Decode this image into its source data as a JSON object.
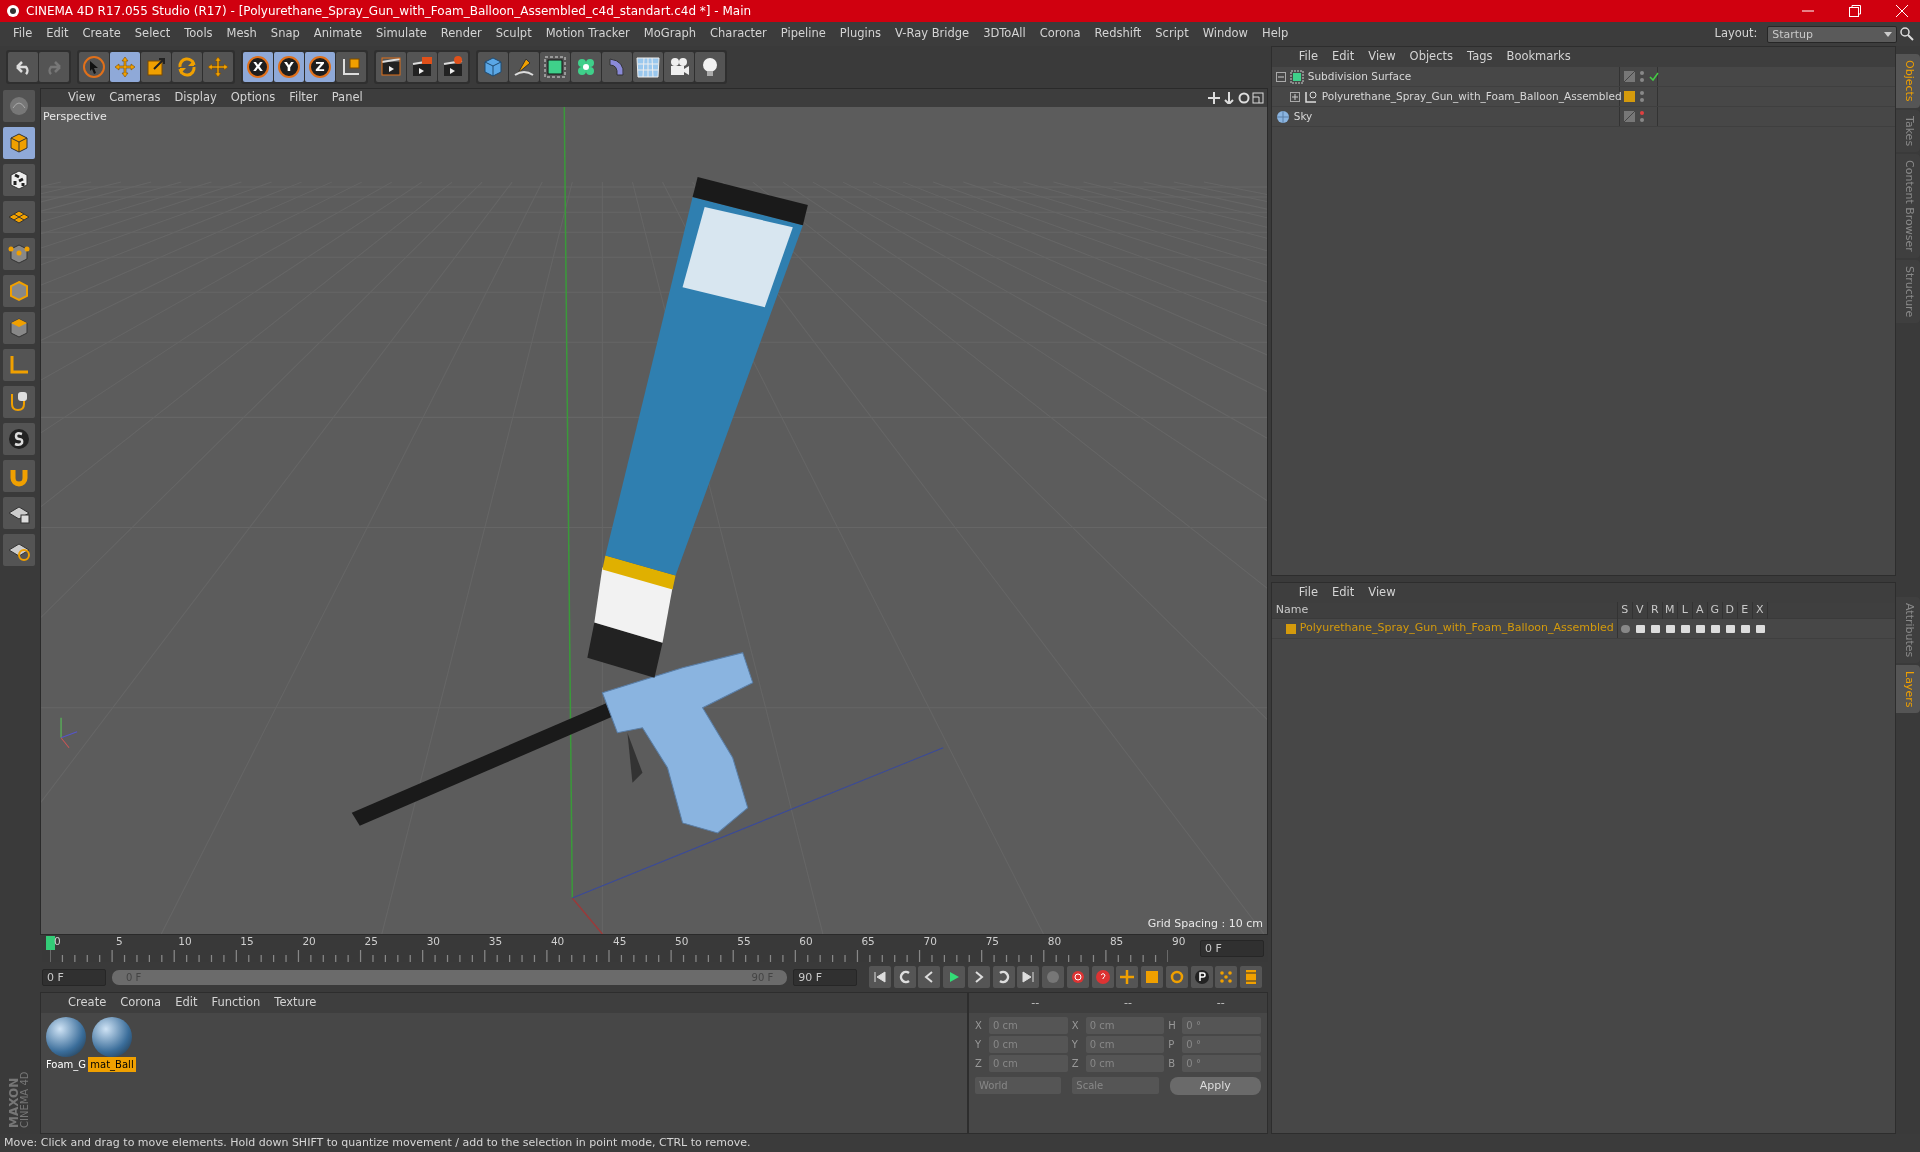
{
  "window": {
    "title": "CINEMA 4D R17.055 Studio (R17) - [Polyurethane_Spray_Gun_with_Foam_Balloon_Assembled_c4d_standart.c4d *] - Main"
  },
  "menu": [
    "File",
    "Edit",
    "Create",
    "Select",
    "Tools",
    "Mesh",
    "Snap",
    "Animate",
    "Simulate",
    "Render",
    "Sculpt",
    "Motion Tracker",
    "MoGraph",
    "Character",
    "Pipeline",
    "Plugins",
    "V-Ray Bridge",
    "3DToAll",
    "Corona",
    "Redshift",
    "Script",
    "Window",
    "Help"
  ],
  "layout": {
    "label": "Layout:",
    "value": "Startup"
  },
  "toolbar": [
    {
      "kind": "undo",
      "selected": false
    },
    {
      "kind": "redo",
      "selected": false
    },
    {
      "kind": "select",
      "selected": false
    },
    {
      "kind": "move",
      "selected": true
    },
    {
      "kind": "scale",
      "selected": false
    },
    {
      "kind": "rotate",
      "selected": false
    },
    {
      "kind": "move",
      "selected": false
    },
    {
      "kind": "axis",
      "label": "X",
      "selected": true
    },
    {
      "kind": "axis",
      "label": "Y",
      "selected": true
    },
    {
      "kind": "axis",
      "label": "Z",
      "selected": true
    },
    {
      "kind": "coords",
      "selected": false
    },
    {
      "kind": "render-view",
      "selected": false
    },
    {
      "kind": "render",
      "selected": false
    },
    {
      "kind": "render-settings",
      "selected": false
    },
    {
      "kind": "cube",
      "selected": false
    },
    {
      "kind": "pen",
      "selected": false
    },
    {
      "kind": "subdiv",
      "selected": false
    },
    {
      "kind": "cloner",
      "selected": false
    },
    {
      "kind": "deformer",
      "selected": false
    },
    {
      "kind": "floor",
      "selected": false
    },
    {
      "kind": "camera",
      "selected": false
    },
    {
      "kind": "light",
      "selected": false
    }
  ],
  "left_tools": [
    {
      "kind": "sculpt",
      "selected": false
    },
    {
      "kind": "model",
      "selected": true
    },
    {
      "kind": "texture",
      "selected": false
    },
    {
      "kind": "workplane",
      "selected": false
    },
    {
      "kind": "points",
      "selected": false
    },
    {
      "kind": "edges",
      "selected": false
    },
    {
      "kind": "polygons",
      "selected": false
    },
    {
      "kind": "axis",
      "selected": false
    },
    {
      "kind": "tweak",
      "selected": false
    },
    {
      "kind": "snap",
      "selected": false
    },
    {
      "kind": "magnet",
      "selected": false
    },
    {
      "kind": "grid-lock",
      "selected": false
    },
    {
      "kind": "grid-snap",
      "selected": false
    }
  ],
  "viewport": {
    "menu": [
      "View",
      "Cameras",
      "Display",
      "Options",
      "Filter",
      "Panel"
    ],
    "camera": "Perspective",
    "grid_spacing": "Grid Spacing : 10 cm"
  },
  "object_manager": {
    "menu": [
      "File",
      "Edit",
      "View",
      "Objects",
      "Tags",
      "Bookmarks"
    ],
    "objects": [
      {
        "name": "Subdivision Surface",
        "kind": "subdiv",
        "expanded": true,
        "checked": true,
        "children": [
          {
            "name": "Polyurethane_Spray_Gun_with_Foam_Balloon_Assembled",
            "kind": "null",
            "expanded": false,
            "color": "#d49a0c"
          }
        ]
      },
      {
        "name": "Sky",
        "kind": "sky"
      }
    ]
  },
  "layer_manager": {
    "menu": [
      "File",
      "Edit",
      "View"
    ],
    "columns": [
      "Name",
      "S",
      "V",
      "R",
      "M",
      "L",
      "A",
      "G",
      "D",
      "E",
      "X"
    ],
    "rows": [
      {
        "name": "Polyurethane_Spray_Gun_with_Foam_Balloon_Assembled",
        "color": "#d49a0c"
      }
    ]
  },
  "side_tabs_top": [
    {
      "label": "Objects",
      "selected": true
    },
    {
      "label": "Takes",
      "selected": false
    },
    {
      "label": "Content Browser",
      "selected": false
    },
    {
      "label": "Structure",
      "selected": false
    }
  ],
  "side_tabs_bottom": [
    {
      "label": "Attributes",
      "selected": false
    },
    {
      "label": "Layers",
      "selected": true
    }
  ],
  "timeline": {
    "ticks": [
      "0",
      "5",
      "10",
      "15",
      "20",
      "25",
      "30",
      "35",
      "40",
      "45",
      "50",
      "55",
      "60",
      "65",
      "70",
      "75",
      "80",
      "85",
      "90"
    ],
    "current_frame": "0 F",
    "level": 0
  },
  "transport": {
    "level": 1,
    "start": "0 F",
    "range_start": "0 F",
    "range_end": "90 F",
    "end": "90 F"
  },
  "material_manager": {
    "menu": [
      "Create",
      "Corona",
      "Edit",
      "Function",
      "Texture"
    ],
    "materials": [
      {
        "name": "Foam_G",
        "selected": false
      },
      {
        "name": "mat_Ball",
        "selected": true
      }
    ]
  },
  "coordinates": {
    "headers": [
      "--",
      "--",
      "--"
    ],
    "rows": [
      {
        "label_1": "X",
        "value_1": "0 cm",
        "label_2": "X",
        "value_2": "0 cm",
        "label_3": "H",
        "value_3": "0 °"
      },
      {
        "label_1": "Y",
        "value_1": "0 cm",
        "label_2": "Y",
        "value_2": "0 cm",
        "label_3": "P",
        "value_3": "0 °"
      },
      {
        "label_1": "Z",
        "value_1": "0 cm",
        "label_2": "Z",
        "value_2": "0 cm",
        "label_3": "B",
        "value_3": "0 °"
      }
    ],
    "mode": "World",
    "size_mode": "Scale",
    "apply": "Apply"
  },
  "logo": {
    "line_1": "MAXON",
    "line_2": "CINEMA 4D"
  },
  "status_bar": "Move: Click and drag to move elements. Hold down SHIFT to quantize movement / add to the selection in point mode, CTRL to remove."
}
